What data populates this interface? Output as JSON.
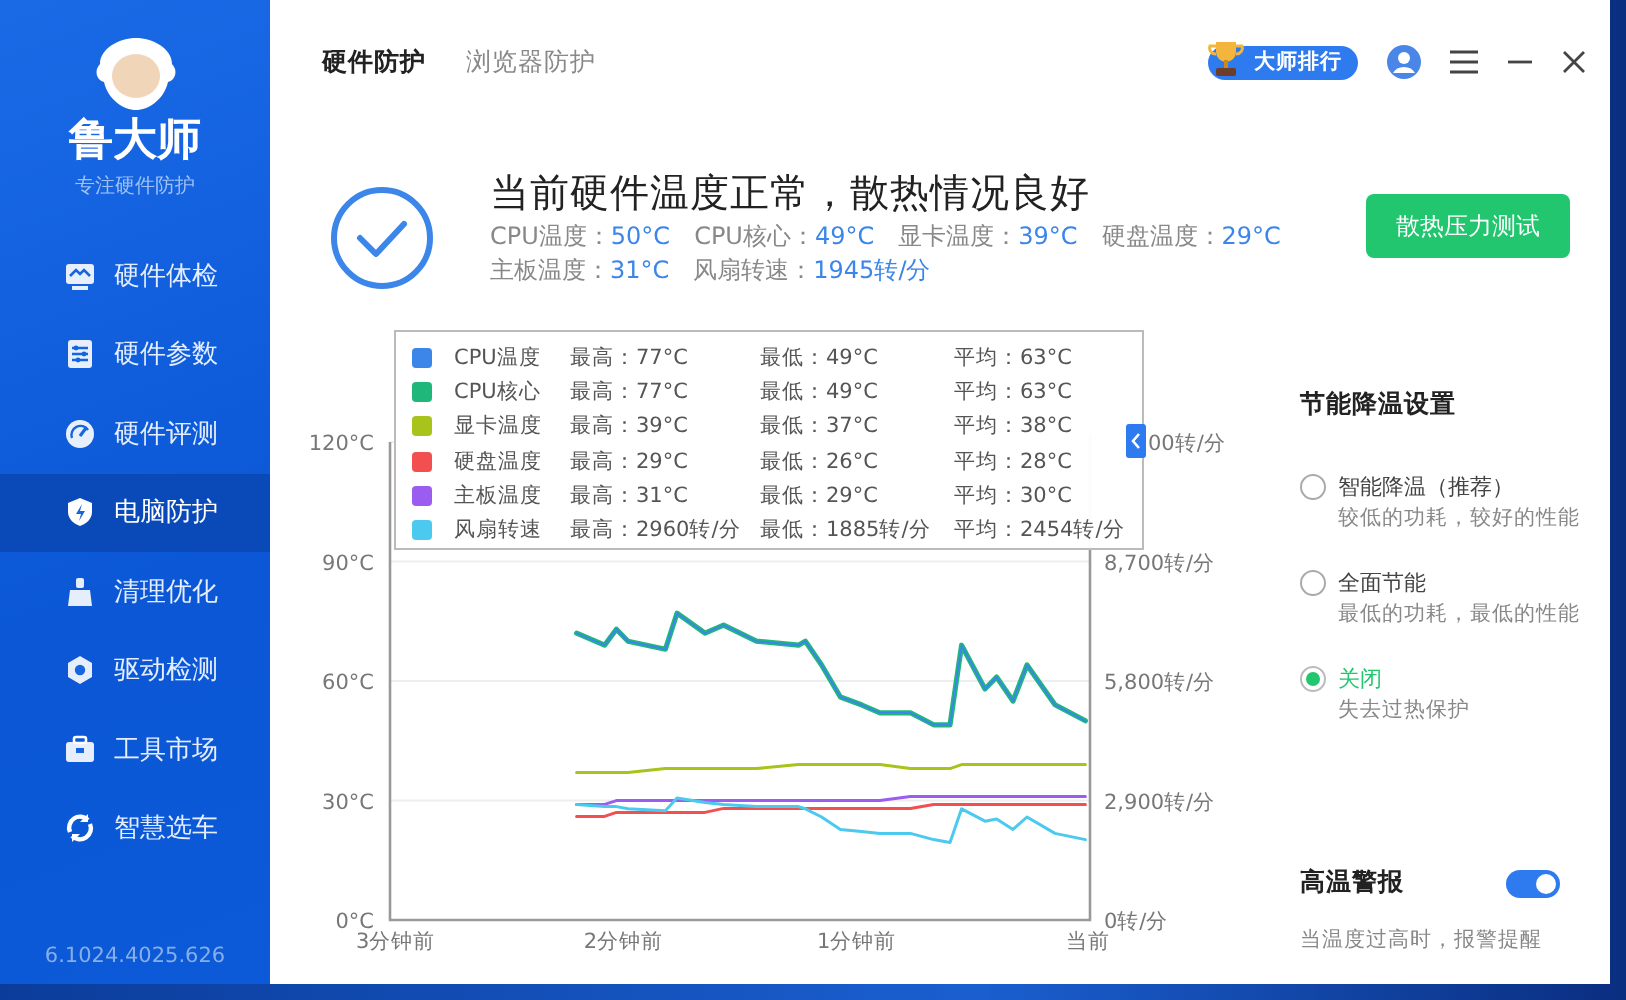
{
  "sidebar": {
    "logo_title": "鲁大师",
    "logo_subtitle": "专注硬件防护",
    "items": [
      {
        "label": "硬件体检",
        "selected": false
      },
      {
        "label": "硬件参数",
        "selected": false
      },
      {
        "label": "硬件评测",
        "selected": false
      },
      {
        "label": "电脑防护",
        "selected": true
      },
      {
        "label": "清理优化",
        "selected": false
      },
      {
        "label": "驱动检测",
        "selected": false
      },
      {
        "label": "工具市场",
        "selected": false
      },
      {
        "label": "智慧选车",
        "selected": false
      }
    ],
    "version": "6.1024.4025.626"
  },
  "header": {
    "tabs": [
      {
        "label": "硬件防护",
        "selected": true
      },
      {
        "label": "浏览器防护",
        "selected": false
      }
    ],
    "rank_badge": "大师排行"
  },
  "status": {
    "title": "当前硬件温度正常，散热情况良好",
    "readings": [
      [
        {
          "label": "CPU温度：",
          "value": "50°C"
        },
        {
          "label": "CPU核心：",
          "value": "49°C"
        },
        {
          "label": "显卡温度：",
          "value": "39°C"
        },
        {
          "label": "硬盘温度：",
          "value": "29°C"
        }
      ],
      [
        {
          "label": "主板温度：",
          "value": "31°C"
        },
        {
          "label": "风扇转速：",
          "value": "1945转/分"
        }
      ]
    ],
    "button": "散热压力测试"
  },
  "chart": {
    "chart_data": {
      "type": "line",
      "x": [
        2.2,
        2.08,
        2.03,
        1.98,
        1.82,
        1.77,
        1.65,
        1.57,
        1.43,
        1.25,
        1.22,
        1.15,
        1.07,
        0.98,
        0.9,
        0.77,
        0.67,
        0.6,
        0.55,
        0.45,
        0.4,
        0.33,
        0.27,
        0.15,
        0.02
      ],
      "xlim": [
        3,
        0
      ],
      "ylim": [
        0,
        120
      ],
      "y2lim": [
        0,
        11600
      ],
      "grid": true,
      "xticks": [
        {
          "value": 3,
          "label": "3分钟前"
        },
        {
          "value": 2,
          "label": "2分钟前"
        },
        {
          "value": 1,
          "label": "1分钟前"
        },
        {
          "value": 0,
          "label": "当前"
        }
      ],
      "yticks": [
        {
          "value": 0,
          "label": "0°C"
        },
        {
          "value": 30,
          "label": "30°C"
        },
        {
          "value": 60,
          "label": "60°C"
        },
        {
          "value": 90,
          "label": "90°C"
        },
        {
          "value": 120,
          "label": "120°C"
        }
      ],
      "y2ticks": [
        {
          "value": 0,
          "label": "0转/分"
        },
        {
          "value": 2900,
          "label": "2,900转/分"
        },
        {
          "value": 5800,
          "label": "5,800转/分"
        },
        {
          "value": 8700,
          "label": "8,700转/分"
        }
      ],
      "series": [
        {
          "name": "CPU温度",
          "color": "#3b86e8",
          "values": [
            72,
            69,
            73,
            70,
            68,
            77,
            72,
            74,
            70,
            69,
            70,
            64,
            56,
            54,
            52,
            52,
            49,
            49,
            69,
            58,
            61,
            55,
            64,
            54,
            50
          ]
        },
        {
          "name": "CPU核心",
          "color": "#1fb87a",
          "values": [
            72,
            69,
            73,
            70,
            68,
            77,
            72,
            74,
            70,
            69,
            70,
            64,
            56,
            54,
            52,
            52,
            49,
            49,
            69,
            58,
            61,
            55,
            64,
            54,
            50
          ]
        },
        {
          "name": "显卡温度",
          "color": "#a8c31a",
          "values": [
            37,
            37,
            37,
            37,
            38,
            38,
            38,
            38,
            38,
            39,
            39,
            39,
            39,
            39,
            39,
            38,
            38,
            38,
            39,
            39,
            39,
            39,
            39,
            39,
            39
          ]
        },
        {
          "name": "硬盘温度",
          "color": "#f25050",
          "values": [
            26,
            26,
            27,
            27,
            27,
            27,
            27,
            28,
            28,
            28,
            28,
            28,
            28,
            28,
            28,
            28,
            29,
            29,
            29,
            29,
            29,
            29,
            29,
            29,
            29
          ]
        },
        {
          "name": "主板温度",
          "color": "#9b5cf0",
          "values": [
            29,
            29,
            30,
            30,
            30,
            30,
            30,
            30,
            30,
            30,
            30,
            30,
            30,
            30,
            30,
            31,
            31,
            31,
            31,
            31,
            31,
            31,
            31,
            31,
            31
          ]
        },
        {
          "name": "风扇转速",
          "color": "#4cc9ee",
          "axis": "y2",
          "values": [
            2800,
            2750,
            2750,
            2700,
            2650,
            2960,
            2850,
            2800,
            2750,
            2750,
            2700,
            2500,
            2200,
            2150,
            2100,
            2100,
            1950,
            1885,
            2700,
            2400,
            2450,
            2200,
            2500,
            2100,
            1950
          ]
        }
      ]
    },
    "right_axis_top_label": "00转/分",
    "tooltip": {
      "rows": [
        {
          "max": "最高：77°C",
          "min": "最低：49°C",
          "avg": "平均：63°C"
        },
        {
          "max": "最高：77°C",
          "min": "最低：49°C",
          "avg": "平均：63°C"
        },
        {
          "max": "最高：39°C",
          "min": "最低：37°C",
          "avg": "平均：38°C"
        },
        {
          "max": "最高：29°C",
          "min": "最低：26°C",
          "avg": "平均：28°C"
        },
        {
          "max": "最高：31°C",
          "min": "最低：29°C",
          "avg": "平均：30°C"
        },
        {
          "max": "最高：2960转/分",
          "min": "最低：1885转/分",
          "avg": "平均：2454转/分"
        }
      ]
    }
  },
  "settings": {
    "title": "节能降温设置",
    "options": [
      {
        "label": "智能降温（推荐）",
        "desc": "较低的功耗，较好的性能",
        "selected": false
      },
      {
        "label": "全面节能",
        "desc": "最低的功耗，最低的性能",
        "selected": false
      },
      {
        "label": "关闭",
        "desc": "失去过热保护",
        "selected": true
      }
    ],
    "alert": {
      "title": "高温警报",
      "on": true,
      "desc": "当温度过高时，报警提醒"
    }
  }
}
